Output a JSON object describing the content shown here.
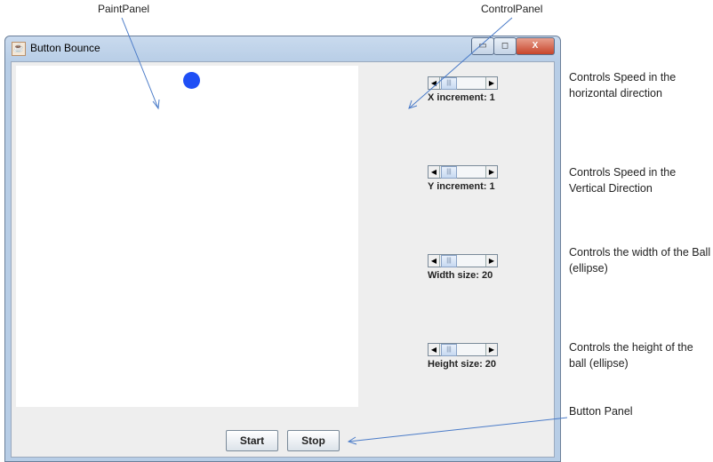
{
  "window": {
    "title": "Button Bounce",
    "app_icon": "java-icon",
    "minimize": "minimize-icon",
    "maximize": "maximize-icon",
    "close": "close-icon"
  },
  "controls": [
    {
      "label": "X increment: 1",
      "value": 1
    },
    {
      "label": "Y increment: 1",
      "value": 1
    },
    {
      "label": "Width size: 20",
      "value": 20
    },
    {
      "label": "Height size: 20",
      "value": 20
    }
  ],
  "buttons": {
    "start": "Start",
    "stop": "Stop"
  },
  "ball_color": "#1f4ff5",
  "annotations": {
    "paint_panel": "PaintPanel",
    "control_panel": "ControlPanel",
    "button_panel": "Button Panel",
    "notes": [
      "Controls Speed in the horizontal direction",
      "Controls Speed in the Vertical Direction",
      "Controls the width of the Ball (ellipse)",
      "Controls the height of the ball (ellipse)"
    ]
  }
}
